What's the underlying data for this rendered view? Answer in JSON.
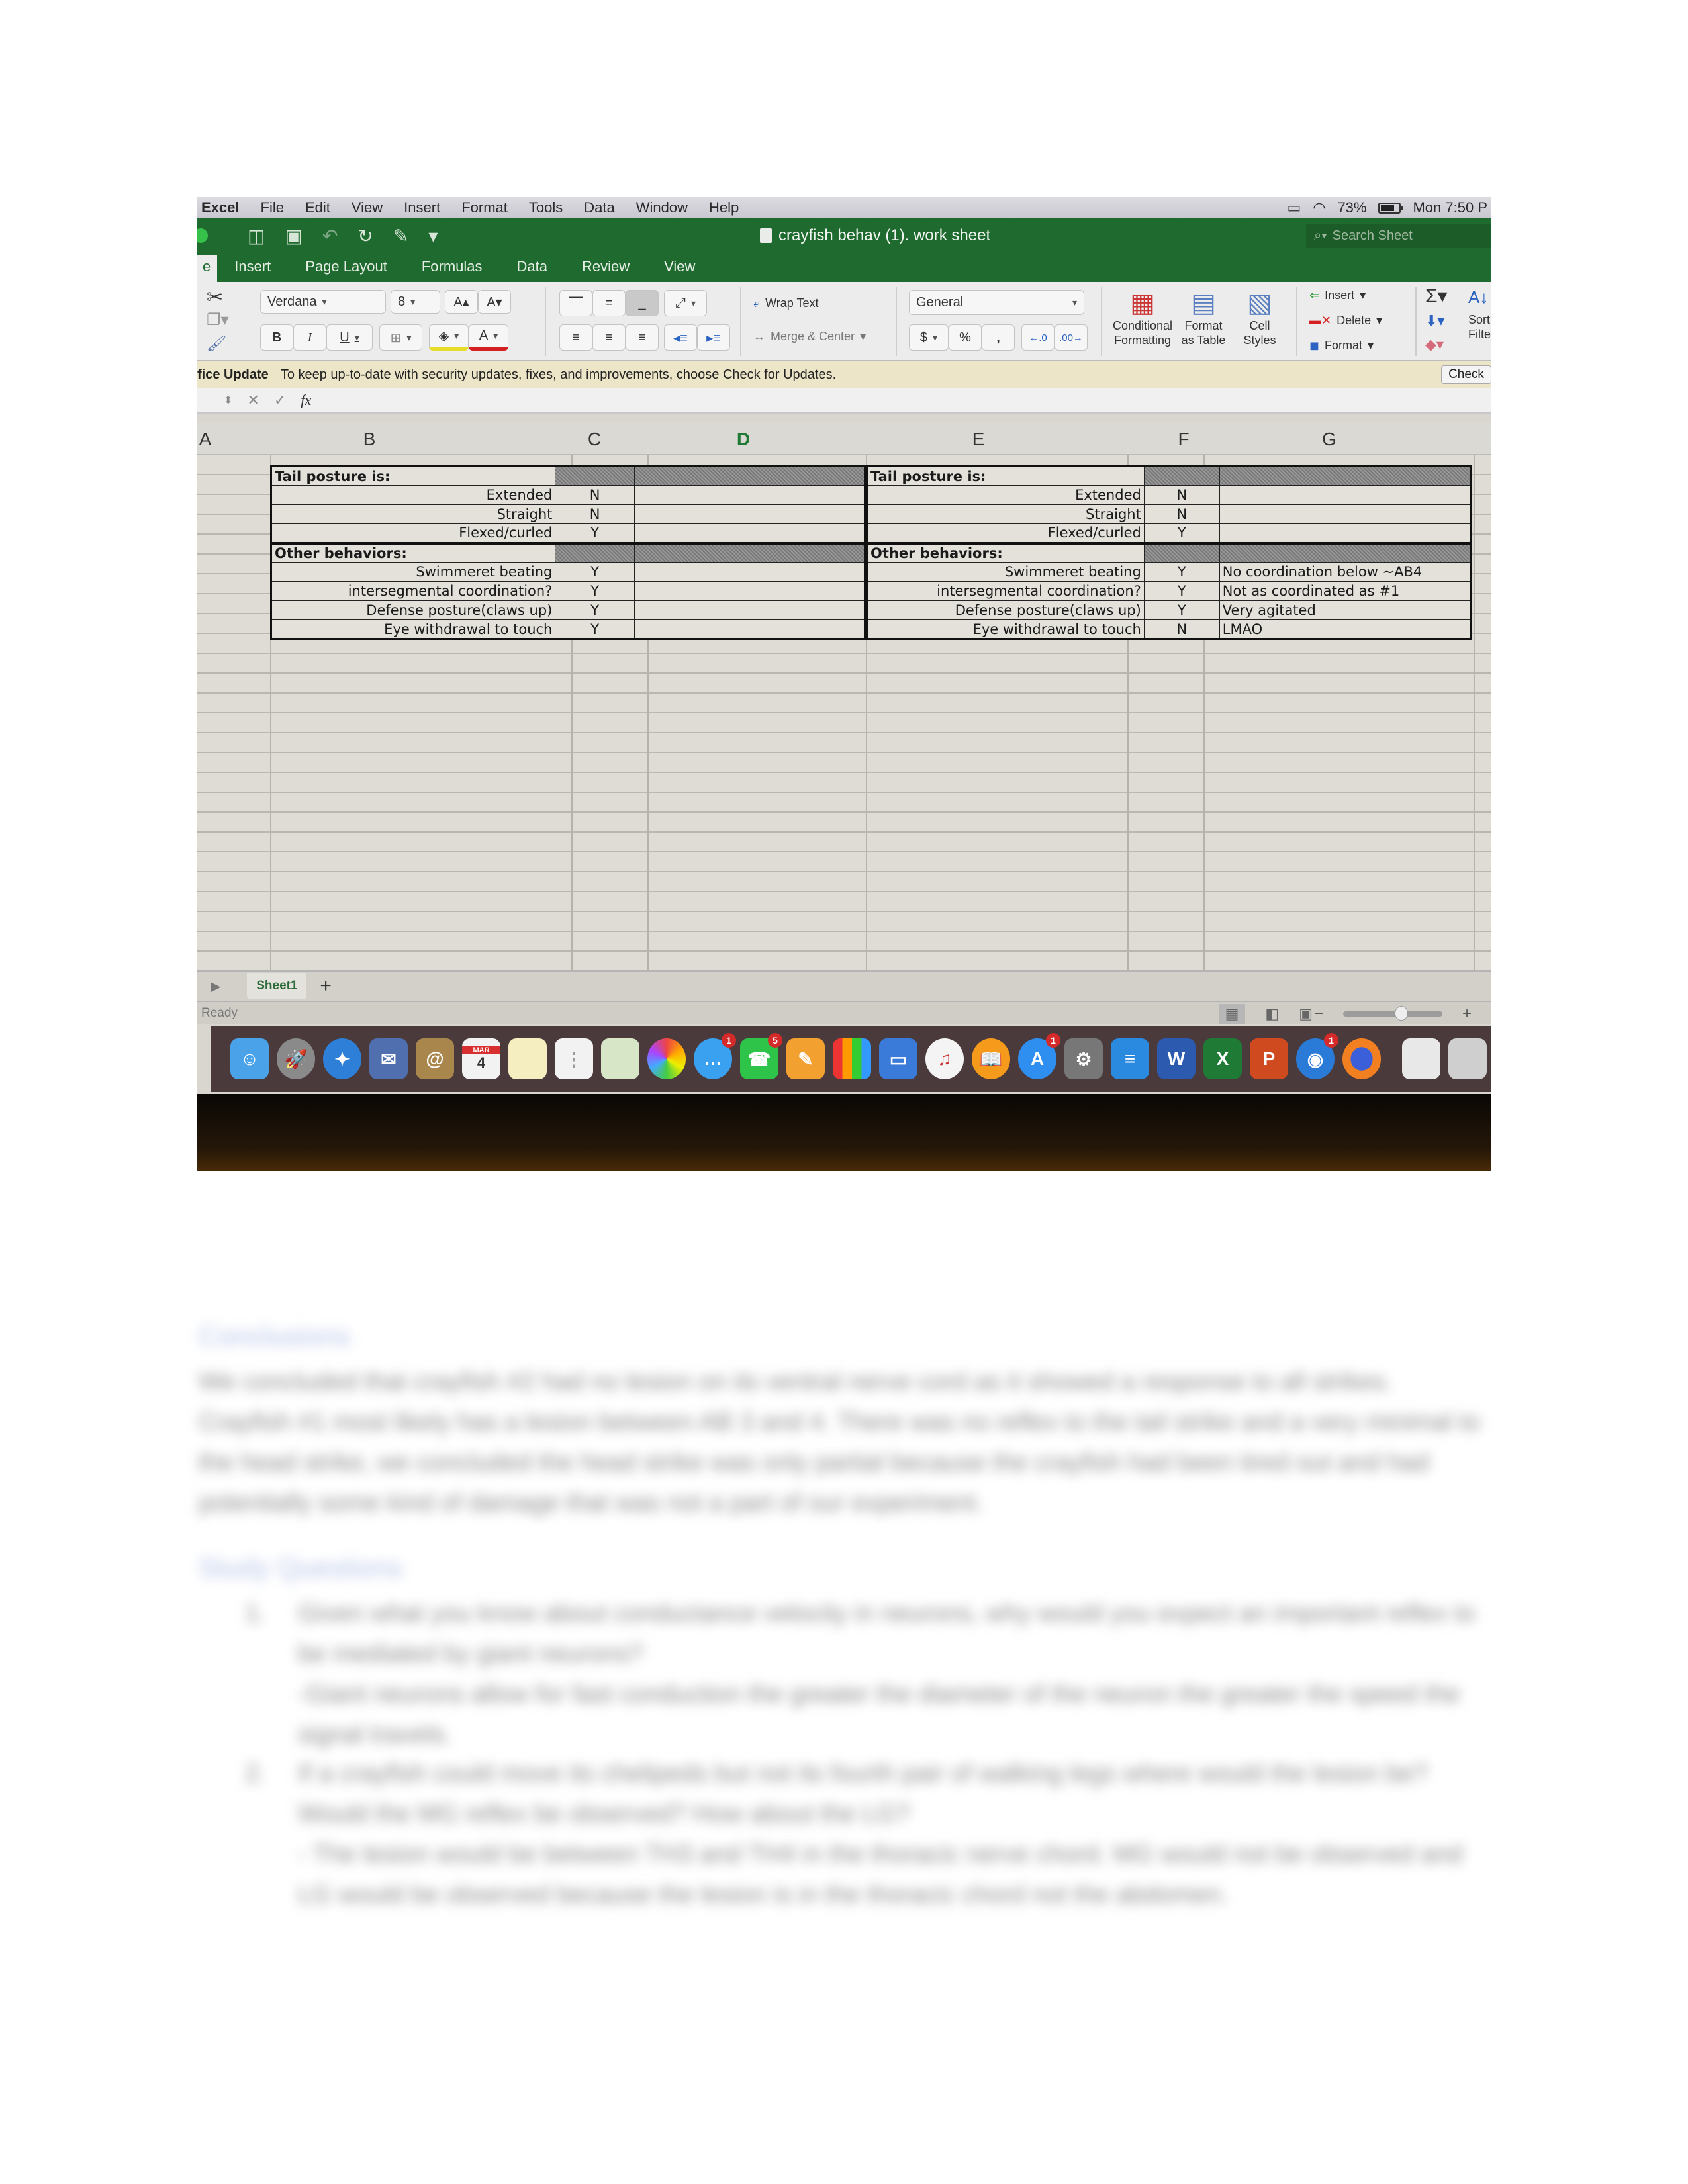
{
  "menubar": {
    "app": "Excel",
    "items": [
      "File",
      "Edit",
      "View",
      "Insert",
      "Format",
      "Tools",
      "Data",
      "Window",
      "Help"
    ],
    "battery": "73%",
    "clock": "Mon 7:50 P"
  },
  "titlebar": {
    "document_title": "crayfish behav (1). work sheet",
    "search_placeholder": "Search Sheet"
  },
  "ribbon_tabs": [
    "e",
    "Insert",
    "Page Layout",
    "Formulas",
    "Data",
    "Review",
    "View"
  ],
  "ribbon": {
    "font_name": "Verdana",
    "font_size": "8",
    "wrap_text": "Wrap Text",
    "merge_center": "Merge & Center",
    "number_format": "General",
    "currency": "$",
    "percent": "%",
    "comma": ",",
    "conditional_formatting": "Conditional Formatting",
    "format_as_table": "Format as Table",
    "cell_styles": "Cell Styles",
    "insert": "Insert",
    "delete": "Delete",
    "format": "Format",
    "sort_filter": "Sort Filte",
    "bold": "B",
    "italic": "I",
    "underline": "U"
  },
  "update_bar": {
    "title": "fice Update",
    "message": "To keep up-to-date with security updates, fixes, and improvements, choose Check for Updates.",
    "button": "Check"
  },
  "formula_bar": {
    "cancel": "✕",
    "enter": "✓",
    "fx": "fx"
  },
  "columns": [
    "A",
    "B",
    "C",
    "D",
    "E",
    "F",
    "G"
  ],
  "active_column": "D",
  "table_left": {
    "sections": [
      {
        "header": "Tail posture is:",
        "rows": [
          {
            "label": "Extended",
            "value": "N"
          },
          {
            "label": "Straight",
            "value": "N"
          },
          {
            "label": "Flexed/curled",
            "value": "Y"
          }
        ]
      },
      {
        "header": "Other behaviors:",
        "rows": [
          {
            "label": "Swimmeret beating",
            "value": "Y"
          },
          {
            "label": "intersegmental coordination?",
            "value": "Y"
          },
          {
            "label": "Defense posture(claws up)",
            "value": "Y"
          },
          {
            "label": "Eye withdrawal to touch",
            "value": "Y"
          }
        ]
      }
    ]
  },
  "table_right": {
    "sections": [
      {
        "header": "Tail posture is:",
        "rows": [
          {
            "label": "Extended",
            "value": "N",
            "note": ""
          },
          {
            "label": "Straight",
            "value": "N",
            "note": ""
          },
          {
            "label": "Flexed/curled",
            "value": "Y",
            "note": ""
          }
        ]
      },
      {
        "header": "Other behaviors:",
        "rows": [
          {
            "label": "Swimmeret beating",
            "value": "Y",
            "note": "No coordination below ~AB4"
          },
          {
            "label": "intersegmental coordination?",
            "value": "Y",
            "note": "Not as coordinated as #1"
          },
          {
            "label": "Defense posture(claws up)",
            "value": "Y",
            "note": "Very agitated"
          },
          {
            "label": "Eye withdrawal to touch",
            "value": "N",
            "note": "LMAO"
          }
        ]
      }
    ]
  },
  "sheet_tabs": [
    "Sheet1"
  ],
  "add_sheet": "+",
  "status": "Ready",
  "zoom_slider_fraction": 0.6,
  "dock": {
    "calendar_month": "MAR",
    "calendar_day": "4",
    "messages_badge": "1",
    "facetime_badge": "5",
    "appstore_badge": "1",
    "network_badge": "1",
    "apps": [
      "Finder",
      "Launchpad",
      "Safari",
      "Mail",
      "Contacts",
      "Calendar",
      "Notes",
      "Reminders",
      "Maps",
      "Photos",
      "Messages",
      "FaceTime",
      "Pages",
      "Numbers",
      "Keynote",
      "iTunes",
      "iBooks",
      "App Store",
      "System Preferences",
      "Notifier",
      "Word",
      "Excel",
      "PowerPoint",
      "Network",
      "Firefox",
      "Downloads",
      "Trash"
    ]
  },
  "document": {
    "conclusions_heading": "Conclusions",
    "conclusions_text": "We concluded that crayfish #2 had no lesion on its ventral nerve cord as it showed a response to all strikes. Crayfish #1 most likely has a lesion between AB 3 and 4. There was no reflex to the tail strike and a very minimal to the head strike, we concluded the head strike was only partial because the crayfish had been tired out and had potentially some kind of damage that was not a part of our experiment.",
    "questions_heading": "Study Questions",
    "questions": [
      {
        "number": "1.",
        "question": "Given what you know about conductance velocity in neurons, why would you expect an important reflex to be mediated by giant neurons?",
        "answer": "-Giant neurons allow for fast conduction the greater the diameter of the neuron the greater the speed the signal travels."
      },
      {
        "number": "2.",
        "question": "If a crayfish could move its chelipeds but not its fourth pair of walking legs where would the lesion be? Would the MG reflex be observed? How about the LG?",
        "answer": "- The lesion would be between TH3 and TH4 in the thoracic nerve chord. MG would not be observed and LG would be observed because the lesion is in the thoracic chord not the abdomen."
      }
    ]
  }
}
